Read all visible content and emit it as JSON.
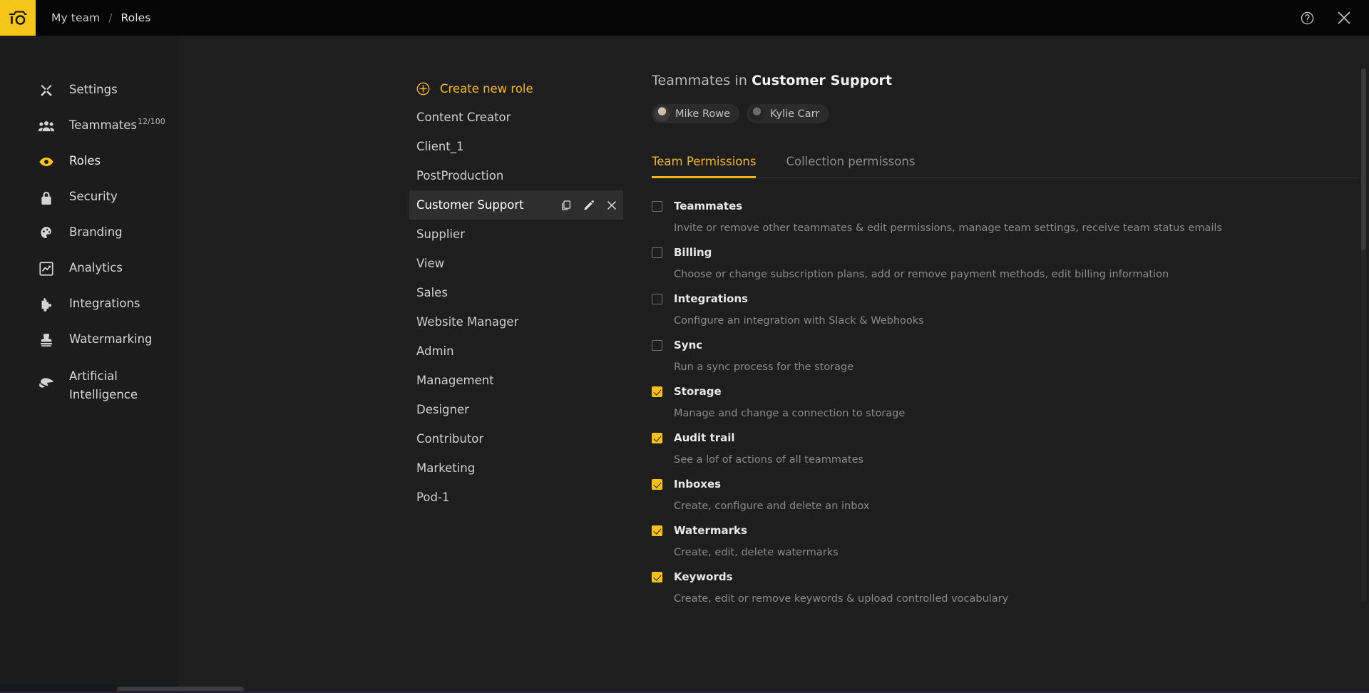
{
  "topbar": {
    "logo_icon": "io-camera-logo",
    "breadcrumb": {
      "root": "My team",
      "separator": "/",
      "current": "Roles"
    },
    "help_icon": "help-circle-icon",
    "close_icon": "close-icon"
  },
  "sidebar": {
    "items": [
      {
        "label": "Settings",
        "icon": "tools-icon",
        "active": false,
        "sup": ""
      },
      {
        "label": "Teammates",
        "icon": "people-icon",
        "active": false,
        "sup": "12/100"
      },
      {
        "label": "Roles",
        "icon": "eye-icon",
        "active": true,
        "sup": ""
      },
      {
        "label": "Security",
        "icon": "lock-icon",
        "active": false,
        "sup": ""
      },
      {
        "label": "Branding",
        "icon": "palette-icon",
        "active": false,
        "sup": ""
      },
      {
        "label": "Analytics",
        "icon": "chart-square-icon",
        "active": false,
        "sup": ""
      },
      {
        "label": "Integrations",
        "icon": "puzzle-icon",
        "active": false,
        "sup": ""
      },
      {
        "label": "Watermarking",
        "icon": "stamp-icon",
        "active": false,
        "sup": ""
      }
    ],
    "ai_item": {
      "line1": "Artificial",
      "line2": "Intelligence",
      "icon": "brain-icon"
    }
  },
  "roles": {
    "create_label": "Create new role",
    "create_icon": "plus-circle-icon",
    "selected": "Customer Support",
    "row_actions": {
      "duplicate_icon": "copy-icon",
      "edit_icon": "pencil-icon",
      "delete_icon": "close-icon"
    },
    "items": [
      "Content Creator",
      "Client_1",
      "PostProduction",
      "Customer Support",
      "Supplier",
      "View",
      "Sales",
      "Website Manager",
      "Admin",
      "Management",
      "Designer",
      "Contributor",
      "Marketing",
      "Pod-1"
    ]
  },
  "panel": {
    "title_prefix": "Teammates in ",
    "title_role": "Customer Support",
    "teammates": [
      {
        "name": "Mike Rowe",
        "avatar": "avatar-mike-rowe"
      },
      {
        "name": "Kylie Carr",
        "avatar": "avatar-kylie-carr"
      }
    ],
    "tabs": [
      {
        "label": "Team Permissions",
        "active": true
      },
      {
        "label": "Collection permissons",
        "active": false
      }
    ],
    "permissions": [
      {
        "label": "Teammates",
        "checked": false,
        "desc": "Invite or remove other teammates & edit permissions, manage team settings, receive team status emails"
      },
      {
        "label": "Billing",
        "checked": false,
        "desc": "Choose or change subscription plans, add or remove payment methods, edit billing information"
      },
      {
        "label": "Integrations",
        "checked": false,
        "desc": "Configure an integration with Slack & Webhooks"
      },
      {
        "label": "Sync",
        "checked": false,
        "desc": "Run a sync process for the storage"
      },
      {
        "label": "Storage",
        "checked": true,
        "desc": "Manage and change a connection to storage"
      },
      {
        "label": "Audit trail",
        "checked": true,
        "desc": "See a lof of actions of all teammates"
      },
      {
        "label": "Inboxes",
        "checked": true,
        "desc": "Create, configure and delete an inbox"
      },
      {
        "label": "Watermarks",
        "checked": true,
        "desc": "Create, edit, delete watermarks"
      },
      {
        "label": "Keywords",
        "checked": true,
        "desc": "Create, edit or remove keywords & upload controlled vocabulary"
      }
    ]
  },
  "colors": {
    "accent": "#f5c518",
    "accent_text": "#f5b51a",
    "bg": "#1e1e1e",
    "sidebar_bg": "#1c1c1c",
    "topbar_bg": "#050505",
    "selected_row": "#2e2e2e"
  }
}
